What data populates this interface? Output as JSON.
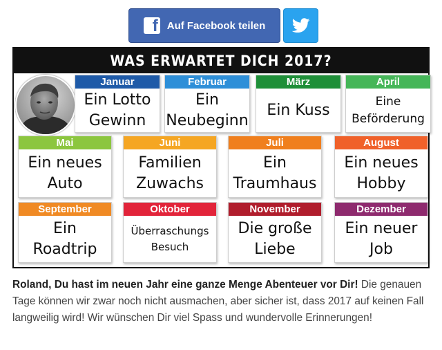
{
  "share": {
    "facebook_label": "Auf Facebook teilen",
    "facebook_icon": "facebook-icon",
    "twitter_icon": "twitter-icon",
    "facebook_color": "#4267b2",
    "twitter_color": "#2aa3ef"
  },
  "calendar": {
    "title": "WAS ERWARTET DICH 2017?",
    "months": [
      {
        "name": "Januar",
        "color": "#1e5aa8",
        "lines": [
          "Ein Lotto",
          "Gewinn"
        ]
      },
      {
        "name": "Februar",
        "color": "#2e8fd8",
        "lines": [
          "Ein",
          "Neubeginn"
        ]
      },
      {
        "name": "März",
        "color": "#1e8f38",
        "lines": [
          "Ein Kuss"
        ]
      },
      {
        "name": "April",
        "color": "#45b658",
        "lines": [
          "Eine",
          "Beförderung"
        ]
      },
      {
        "name": "Mai",
        "color": "#8cc63f",
        "lines": [
          "Ein neues",
          "Auto"
        ]
      },
      {
        "name": "Juni",
        "color": "#f5a623",
        "lines": [
          "Familien",
          "Zuwachs"
        ]
      },
      {
        "name": "Juli",
        "color": "#f07f1d",
        "lines": [
          "Ein",
          "Traumhaus"
        ]
      },
      {
        "name": "August",
        "color": "#f0612a",
        "lines": [
          "Ein neues",
          "Hobby"
        ]
      },
      {
        "name": "September",
        "color": "#f08a24",
        "lines": [
          "Ein",
          "Roadtrip"
        ]
      },
      {
        "name": "Oktober",
        "color": "#e2243a",
        "lines": [
          "Überraschungs",
          "Besuch"
        ]
      },
      {
        "name": "November",
        "color": "#b01d2c",
        "lines": [
          "Die große",
          "Liebe"
        ]
      },
      {
        "name": "Dezember",
        "color": "#8e2a6e",
        "lines": [
          "Ein neuer",
          "Job"
        ]
      }
    ]
  },
  "message": {
    "bold": "Roland, Du hast im neuen Jahr eine ganze Menge Abenteuer vor Dir!",
    "text": " Die genauen Tage können wir zwar noch nicht ausmachen, aber sicher ist, dass 2017 auf keinen Fall langweilig wird! Wir wünschen Dir viel Spass und wundervolle Erinnerungen!"
  }
}
